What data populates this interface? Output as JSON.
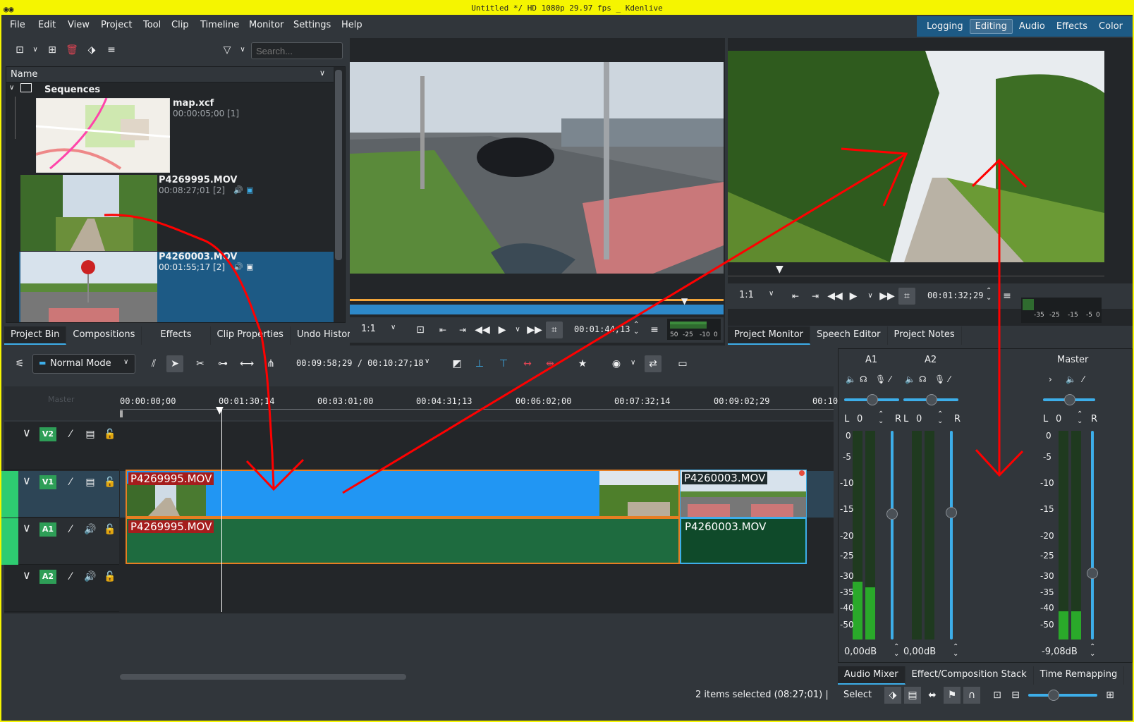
{
  "window": {
    "title": "Untitled */ HD 1080p 29.97 fps  _ Kdenlive"
  },
  "menu": [
    "File",
    "Edit",
    "View",
    "Project",
    "Tool",
    "Clip",
    "Timeline",
    "Monitor",
    "Settings",
    "Help"
  ],
  "layouts": {
    "items": [
      "Logging",
      "Editing",
      "Audio",
      "Effects",
      "Color"
    ],
    "active": "Editing"
  },
  "bin": {
    "search_placeholder": "Search...",
    "column_name": "Name",
    "folder": "Sequences",
    "items": [
      {
        "name": "map.xcf",
        "info": "00:00:05;00 [1]"
      },
      {
        "name": "P4269995.MOV",
        "info": "00:08:27;01 [2]"
      },
      {
        "name": "P4260003.MOV",
        "info": "00:01:55;17 [2]"
      }
    ]
  },
  "left_tabs": [
    "Project Bin",
    "Compositions",
    "Effects",
    "Clip Properties",
    "Undo History"
  ],
  "clip_monitor": {
    "zoom": "1:1",
    "timecode": "00:01:44;13",
    "meter_labels": [
      "50",
      "-25",
      "-10",
      "0"
    ]
  },
  "project_monitor": {
    "zoom": "1:1",
    "timecode": "00:01:32;29",
    "meter_labels": [
      "-35",
      "-25",
      "-15",
      "-5",
      "0"
    ]
  },
  "right_top_tabs": [
    "Project Monitor",
    "Speech Editor",
    "Project Notes"
  ],
  "toolbar": {
    "mode": "Normal Mode",
    "timecode": "00:09:58;29 / 00:10:27;18"
  },
  "ruler": {
    "marks": [
      "00:00:00;00",
      "00:01:30;14",
      "00:03:01;00",
      "00:04:31;13",
      "00:06:02;00",
      "00:07:32;14",
      "00:09:02;29",
      "00:10"
    ],
    "master": "Master"
  },
  "tracks": [
    {
      "name": "V2",
      "type": "video"
    },
    {
      "name": "V1",
      "type": "video"
    },
    {
      "name": "A1",
      "type": "audio"
    },
    {
      "name": "A2",
      "type": "audio"
    }
  ],
  "clips": {
    "v1_a": "P4269995.MOV",
    "v1_b": "P4260003.MOV",
    "a1_a": "P4269995.MOV",
    "a1_b": "P4260003.MOV"
  },
  "mixer": {
    "channels": [
      {
        "name": "A1",
        "pan": "0",
        "db": "0,00dB"
      },
      {
        "name": "A2",
        "pan": "0",
        "db": "0,00dB"
      },
      {
        "name": "Master",
        "pan": "0",
        "db": "-9,08dB"
      }
    ],
    "scale": [
      "0",
      "-5",
      "-10",
      "-15",
      "-20",
      "-25",
      "-30",
      "-35",
      "-40",
      "-50"
    ],
    "L": "L",
    "R": "R"
  },
  "bottom_tabs": [
    "Audio Mixer",
    "Effect/Composition Stack",
    "Time Remapping"
  ],
  "status": {
    "text": "2 items selected (08:27;01) |",
    "tool": "Select"
  },
  "colors": {
    "accent": "#3daee9",
    "clip_video": "#2196f3",
    "clip_audio": "#1e6b3f",
    "selection": "#e67e22",
    "annotation": "#ff0000"
  }
}
